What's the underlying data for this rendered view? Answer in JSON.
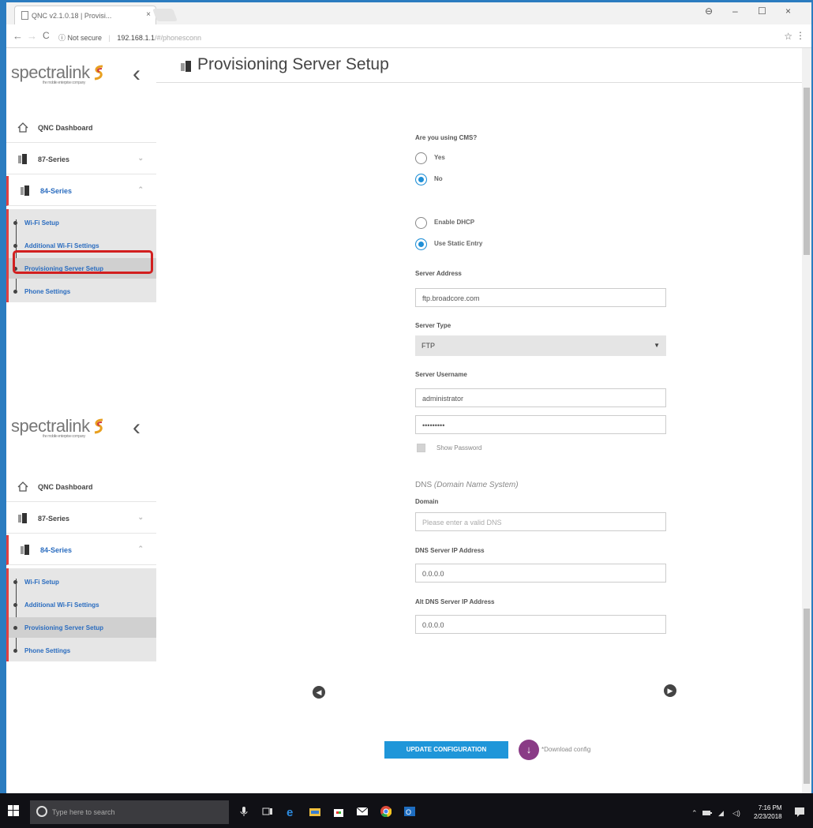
{
  "browser": {
    "tab_title": "QNC v2.1.0.18 | Provisi...",
    "tab_close": "×",
    "controls": {
      "account": "⊖",
      "minimize": "–",
      "maximize": "☐",
      "close": "×"
    },
    "nav": {
      "back": "←",
      "forward": "→",
      "reload": "C"
    },
    "security_label": "ⓘ Not secure",
    "url_host": "192.168.1.1",
    "url_path": "/#/phonesconn",
    "bookmark": "☆",
    "menu": "⋮"
  },
  "logo": {
    "text": "spectralink",
    "tagline": "the mobile enterprise company"
  },
  "sidebar": {
    "back_arrow": "‹",
    "dashboard": "QNC Dashboard",
    "series_87": "87-Series",
    "series_84": "84-Series",
    "chevron": "⌄",
    "sub_items": [
      {
        "label": "Wi-Fi Setup"
      },
      {
        "label": "Additional Wi-Fi Settings"
      },
      {
        "label": "Provisioning Server Setup"
      },
      {
        "label": "Phone Settings"
      }
    ]
  },
  "page": {
    "title": "Provisioning Server Setup"
  },
  "form": {
    "cms_question": "Are you using CMS?",
    "cms_yes": "Yes",
    "cms_no": "No",
    "enable_dhcp": "Enable DHCP",
    "use_static": "Use Static Entry",
    "server_address_label": "Server Address",
    "server_address_value": "ftp.broadcore.com",
    "server_type_label": "Server Type",
    "server_type_value": "FTP",
    "server_username_label": "Server Username",
    "server_username_value": "administrator",
    "password_value": "•••••••••",
    "show_password": "Show Password",
    "dns_heading": "DNS",
    "dns_heading_italic": "(Domain Name System)",
    "domain_label": "Domain",
    "domain_placeholder": "Please enter a valid DNS",
    "dns_ip_label": "DNS Server IP Address",
    "dns_ip_value": "0.0.0.0",
    "alt_dns_ip_label": "Alt DNS Server IP Address",
    "alt_dns_ip_value": "0.0.0.0"
  },
  "actions": {
    "prev": "◀",
    "next": "▶",
    "update": "UPDATE CONFIGURATION",
    "download_icon": "↓",
    "download_label": "*Download config"
  },
  "taskbar": {
    "search_placeholder": "Type here to search",
    "time": "7:16 PM",
    "date": "2/23/2018"
  },
  "colors": {
    "accent": "#1f96d9",
    "selected_border": "#d21f1f",
    "series_active": "#e04040",
    "link": "#2a6cbf"
  }
}
